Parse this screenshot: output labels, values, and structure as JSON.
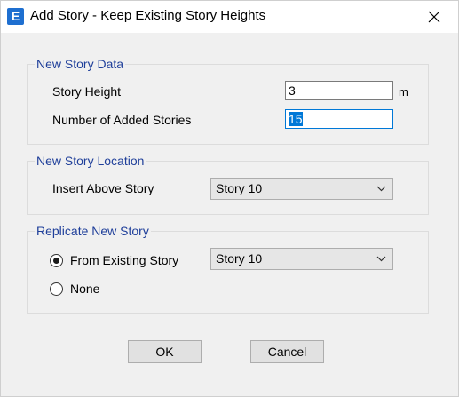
{
  "window": {
    "icon_letter": "E",
    "title": "Add Story - Keep Existing Story Heights",
    "close_glyph": "close-icon"
  },
  "new_story_data": {
    "title": "New Story Data",
    "story_height_label": "Story Height",
    "story_height_value": "3",
    "story_height_unit": "m",
    "added_stories_label": "Number of Added Stories",
    "added_stories_value": "15"
  },
  "new_story_location": {
    "title": "New Story Location",
    "insert_above_label": "Insert Above Story",
    "insert_above_value": "Story 10"
  },
  "replicate_new_story": {
    "title": "Replicate New Story",
    "from_existing_label": "From Existing Story",
    "from_existing_selected": true,
    "from_existing_value": "Story 10",
    "none_label": "None",
    "none_selected": false
  },
  "buttons": {
    "ok_label": "OK",
    "cancel_label": "Cancel"
  },
  "colors": {
    "group_title": "#1f3f9a",
    "accent": "#0078d7",
    "app_icon": "#1e6fd0"
  }
}
